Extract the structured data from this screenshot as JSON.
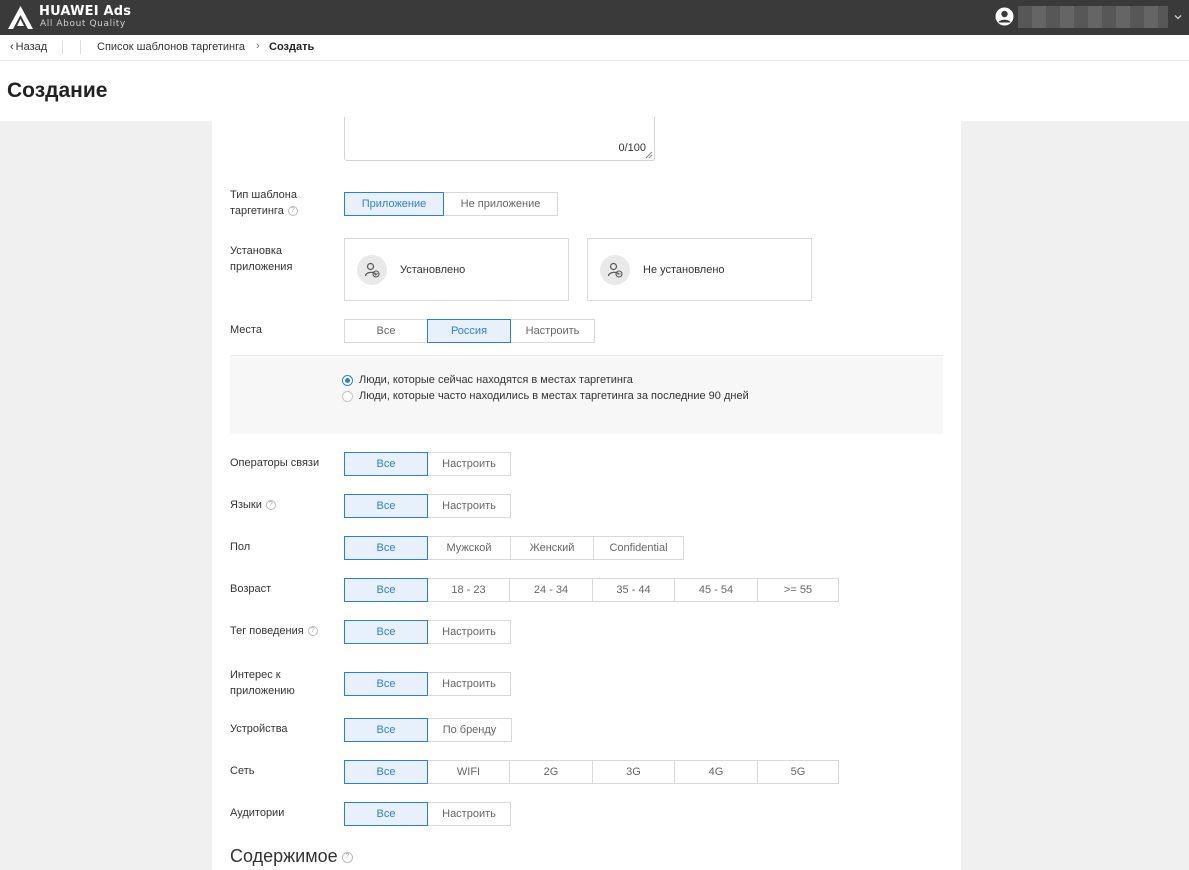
{
  "brand": {
    "name": "HUAWEI Ads",
    "tagline": "All About Quality"
  },
  "breadcrumb": {
    "back_label": "Назад",
    "parent": "Список шаблонов таргетинга",
    "current": "Создать"
  },
  "page": {
    "title": "Создание"
  },
  "description": {
    "counter": "0/100"
  },
  "template_type": {
    "label_line1": "Тип шаблона",
    "label_line2": "таргетинга",
    "options": [
      "Приложение",
      "Не приложение"
    ],
    "selected": "Приложение"
  },
  "app_install": {
    "label_line1": "Установка",
    "label_line2": "приложения",
    "installed": "Установлено",
    "not_installed": "Не установлено"
  },
  "places": {
    "label": "Места",
    "options": [
      "Все",
      "Россия",
      "Настроить"
    ],
    "selected": "Россия",
    "radio_current": "Люди, которые сейчас находятся в местах таргетинга",
    "radio_frequent": "Люди, которые часто находились в местах таргетинга за последние 90 дней"
  },
  "carriers": {
    "label": "Операторы связи",
    "options": [
      "Все",
      "Настроить"
    ],
    "selected": "Все"
  },
  "languages": {
    "label": "Языки",
    "options": [
      "Все",
      "Настроить"
    ],
    "selected": "Все"
  },
  "gender": {
    "label": "Пол",
    "options": [
      "Все",
      "Мужской",
      "Женский",
      "Confidential"
    ],
    "selected": "Все"
  },
  "age": {
    "label": "Возраст",
    "options": [
      "Все",
      "18 - 23",
      "24 - 34",
      "35 - 44",
      "45 - 54",
      ">= 55"
    ],
    "selected": "Все"
  },
  "behavior_tag": {
    "label": "Тег поведения",
    "options": [
      "Все",
      "Настроить"
    ],
    "selected": "Все"
  },
  "app_interest": {
    "label_line1": "Интерес к",
    "label_line2": "приложению",
    "options": [
      "Все",
      "Настроить"
    ],
    "selected": "Все"
  },
  "devices": {
    "label": "Устройства",
    "options": [
      "Все",
      "По бренду"
    ],
    "selected": "Все"
  },
  "network": {
    "label": "Сеть",
    "options": [
      "Все",
      "WIFI",
      "2G",
      "3G",
      "4G",
      "5G"
    ],
    "selected": "Все"
  },
  "audiences": {
    "label": "Аудитории",
    "options": [
      "Все",
      "Настроить"
    ],
    "selected": "Все"
  },
  "content_section": {
    "title": "Содержимое"
  },
  "colors": {
    "accent": "#2f7fd1",
    "accent_bg": "#e8f1fb",
    "topbar": "#3a3a3a"
  }
}
